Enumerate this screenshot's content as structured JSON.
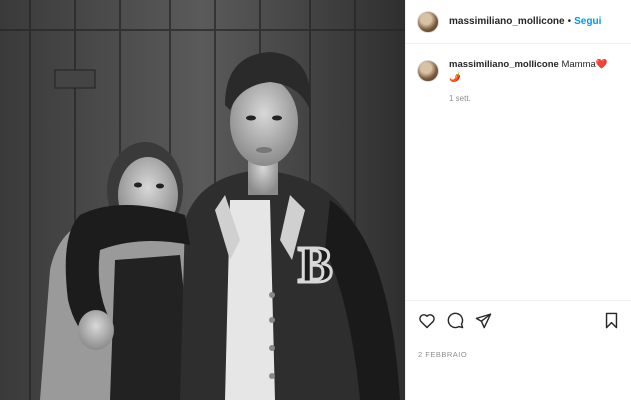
{
  "post": {
    "username": "massimiliano_mollicone",
    "separator": "•",
    "follow_label": "Segui",
    "photo_alt": "",
    "caption": {
      "username": "massimiliano_mollicone",
      "text": "Mamma",
      "emoji_heart": "❤️",
      "emoji_pepper": "🌶️",
      "time": "1 sett."
    },
    "date": "2 FEBBRAIO",
    "icons": {
      "like": "heart-outline-icon",
      "comment": "comment-bubble-icon",
      "share": "paper-plane-icon",
      "save": "bookmark-icon"
    }
  }
}
